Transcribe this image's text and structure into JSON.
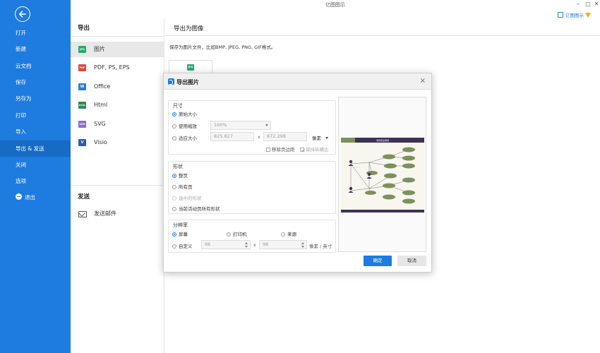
{
  "app": {
    "title": "亿图图示",
    "account_label": "亿图图示"
  },
  "window": {
    "minimize": "–",
    "maximize": "□",
    "close": "✕"
  },
  "sidebar": {
    "items": [
      {
        "label": "打开"
      },
      {
        "label": "新建"
      },
      {
        "label": "云文档"
      },
      {
        "label": "保存"
      },
      {
        "label": "另存为"
      },
      {
        "label": "打印"
      },
      {
        "label": "导入"
      },
      {
        "label": "导出 & 发送",
        "active": true
      },
      {
        "label": "关闭"
      },
      {
        "label": "选项"
      },
      {
        "label": "退出"
      }
    ]
  },
  "export_panel": {
    "title": "导出",
    "formats": [
      {
        "label": "图片",
        "icon": "jpg-icon",
        "active": true,
        "color": "#27a86f",
        "badge": "JPG"
      },
      {
        "label": "PDF, PS, EPS",
        "icon": "pdf-icon",
        "color": "#e5463c",
        "badge": "PDF"
      },
      {
        "label": "Office",
        "icon": "word-icon",
        "color": "#2b7cd3",
        "badge": "W"
      },
      {
        "label": "Html",
        "icon": "html-icon",
        "color": "#2f8a57",
        "badge": "HTML"
      },
      {
        "label": "SVG",
        "icon": "svg-icon",
        "color": "#8a6bd1",
        "badge": "SVG"
      },
      {
        "label": "Visio",
        "icon": "visio-icon",
        "color": "#2a5bb8",
        "badge": "V"
      }
    ],
    "send_title": "发送",
    "send_mail": "发送邮件"
  },
  "content": {
    "title": "导出为图像",
    "description": "保存为图片文件，比如BMP, JPEG, PNG, GIF格式。",
    "thumb_badge": "JPG"
  },
  "dialog": {
    "title": "导出图片",
    "close": "×",
    "size": {
      "label": "尺寸",
      "original": "原始大小",
      "use_zoom": "使用缩放",
      "zoom_value": "100%",
      "fit": "适应大小",
      "width": "825.827",
      "times": "x",
      "height": "672.298",
      "unit": "像素",
      "remove_margin": "移除页边距",
      "keep_ratio": "保持纵横比"
    },
    "shape": {
      "label": "形状",
      "whole_page": "整页",
      "all_pages": "所有页",
      "selected": "选中的形状",
      "current_active": "当前活动页所有形状"
    },
    "resolution": {
      "label": "分辨率",
      "screen": "屏幕",
      "printer": "打印机",
      "source": "来源",
      "custom": "自定义",
      "x_value": "96",
      "times": "x",
      "y_value": "96",
      "unit": "像素 / 英寸"
    },
    "ok": "确定",
    "cancel": "取消",
    "preview_title": "零售职业规划"
  },
  "colors": {
    "accent": "#1e7be0",
    "sidebar_active": "#176bc4",
    "preview_header": "#3d3357",
    "preview_node": "#7e8f5c"
  }
}
